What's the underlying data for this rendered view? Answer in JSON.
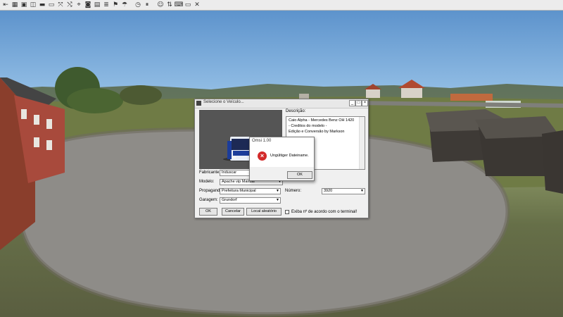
{
  "toolbar": {
    "icons": [
      "exit-icon",
      "map-icon",
      "save-icon",
      "camera-icon",
      "bus-icon",
      "tram-icon",
      "swap-icon",
      "route-icon",
      "signal-icon",
      "vehicle-icon",
      "timetable-icon",
      "options-icon",
      "trip-icon",
      "weather-icon",
      "clock-icon",
      "pause-icon",
      "passenger-icon",
      "switch-icon",
      "keyboard-icon",
      "close-icon"
    ]
  },
  "dialog": {
    "title": "Selecione o Veículo...",
    "description_label": "Descrição:",
    "description_lines": [
      "Caio Alpha - Mercedes Benz OH 1420",
      "",
      "- Creditos do modelo -",
      "",
      "Edição e Conversão by Markson"
    ],
    "manufacturer_label": "Fabricante:",
    "manufacturer_value": "Induscar",
    "model_label": "Modelo:",
    "model_value": "Apache vip Manual",
    "livery_label": "Propaganda:",
    "livery_value": "Prefeitura Municipal",
    "depot_label": "Garagem:",
    "depot_value": "Grundorf",
    "number_label": "Número:",
    "number_value": "3920",
    "ok_label": "OK",
    "cancel_label": "Cancelar",
    "random_label": "Local aleatório",
    "checkbox_label": "Exiba nº de acordo com o terminal!",
    "win_buttons": [
      "_",
      "□",
      "×"
    ]
  },
  "message": {
    "title": "Omsi 1.00",
    "text": "Ungültiger Dateiname.",
    "ok_label": "OK"
  }
}
